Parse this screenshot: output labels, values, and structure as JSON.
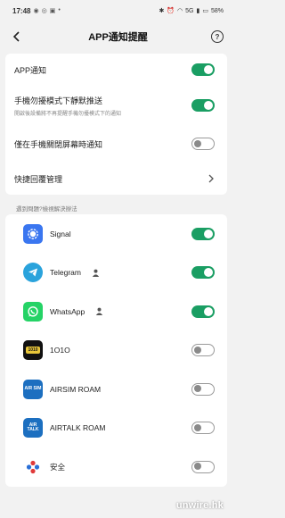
{
  "status_bar": {
    "time": "17:48",
    "battery": "58%",
    "network": "5G"
  },
  "header": {
    "title": "APP通知提醒",
    "help_glyph": "?"
  },
  "settings": [
    {
      "label": "APP通知",
      "enabled": true
    },
    {
      "label": "手機勿擾模式下靜默推送",
      "sub": "開啟後設備將不再提醒手機勿擾模式下的通知",
      "enabled": true
    },
    {
      "label": "僅在手機關閉屏幕時通知",
      "enabled": false
    },
    {
      "label": "快捷回覆管理"
    }
  ],
  "section": {
    "label": "遇到問題?檢視解決辦法"
  },
  "apps": [
    {
      "name": "Signal",
      "enabled": true,
      "icon_color": "#3a76f0",
      "icon": "signal-icon"
    },
    {
      "name": "Telegram",
      "enabled": true,
      "icon_color": "#2aa3dc",
      "icon": "telegram-icon",
      "person": true
    },
    {
      "name": "WhatsApp",
      "enabled": true,
      "icon_color": "#25d366",
      "icon": "whatsapp-icon",
      "person": true
    },
    {
      "name": "1O1O",
      "enabled": false,
      "icon_color": "#111111",
      "icon": "1010-icon",
      "icon_text": "1010"
    },
    {
      "name": "AIRSIM ROAM",
      "enabled": false,
      "icon_color": "#1c6fc0",
      "icon": "airsim-icon",
      "icon_text": "AIR SIM"
    },
    {
      "name": "AIRTALK ROAM",
      "enabled": false,
      "icon_color": "#1c6fc0",
      "icon": "airtalk-icon",
      "icon_text": "AIR TALK"
    },
    {
      "name": "安全",
      "enabled": false,
      "icon_color": "#ffffff",
      "icon": "security-icon"
    }
  ],
  "watermark": "unwire.hk",
  "colors": {
    "toggle_on": "#1a9e63",
    "toggle_off_border": "#9a9a9a",
    "background": "#f2f2f2"
  }
}
